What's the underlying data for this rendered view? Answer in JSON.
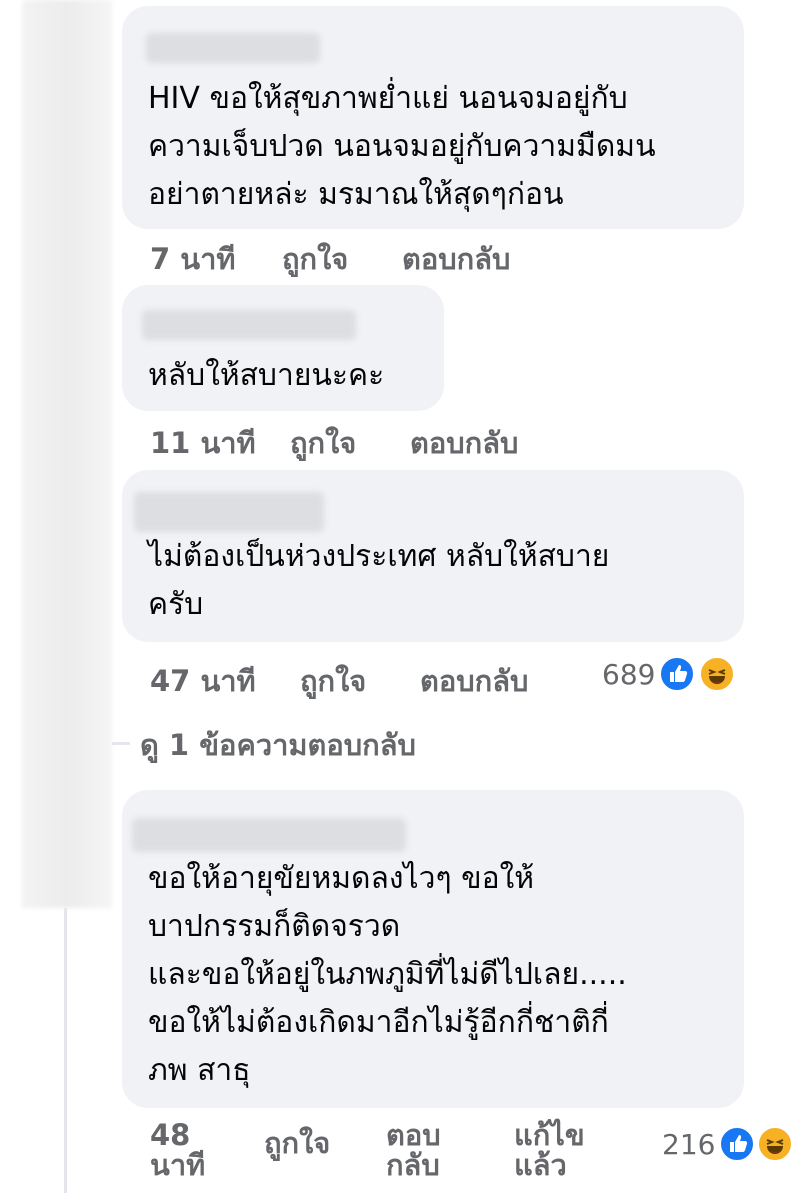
{
  "comments": [
    {
      "lines": [
        "HIV ขอให้สุขภาพย่ำแย่ นอนจมอยู่กับ",
        "ความเจ็บปวด นอนจมอยู่กับความมืดมน",
        "อย่าตายหล่ะ มรมาณให้สุดๆก่อน"
      ],
      "time": "7 นาที",
      "like": "ถูกใจ",
      "reply": "ตอบกลับ"
    },
    {
      "lines": [
        "หลับให้สบายนะคะ"
      ],
      "time": "11 นาที",
      "like": "ถูกใจ",
      "reply": "ตอบกลับ"
    },
    {
      "lines": [
        "ไม่ต้องเป็นห่วงประเทศ หลับให้สบาย",
        "ครับ"
      ],
      "time": "47 นาที",
      "like": "ถูกใจ",
      "reply": "ตอบกลับ",
      "reaction_count": "689"
    },
    {
      "lines": [
        "ขอให้อายุขัยหมดลงไวๆ ขอให้",
        "บาปกรรมก็ติดจรวด",
        "และขอให้อยู่ในภพภูมิที่ไม่ดีไปเลย.....",
        "ขอให้ไม่ต้องเกิดมาอีกไม่รู้อีกกี่ชาติกี่",
        "ภพ สาธุ"
      ],
      "time": "48 นาที",
      "like": "ถูกใจ",
      "reply": "ตอบกลับ",
      "edited": "แก้ไขแล้ว",
      "reaction_count": "216"
    }
  ],
  "view_replies": "ดู 1 ข้อความตอบกลับ",
  "colors": {
    "bubble": "#f0f2f5",
    "meta": "#65676b",
    "like": "#1877f2",
    "haha": "#f7b125"
  },
  "icons": [
    "like-icon",
    "haha-icon"
  ]
}
